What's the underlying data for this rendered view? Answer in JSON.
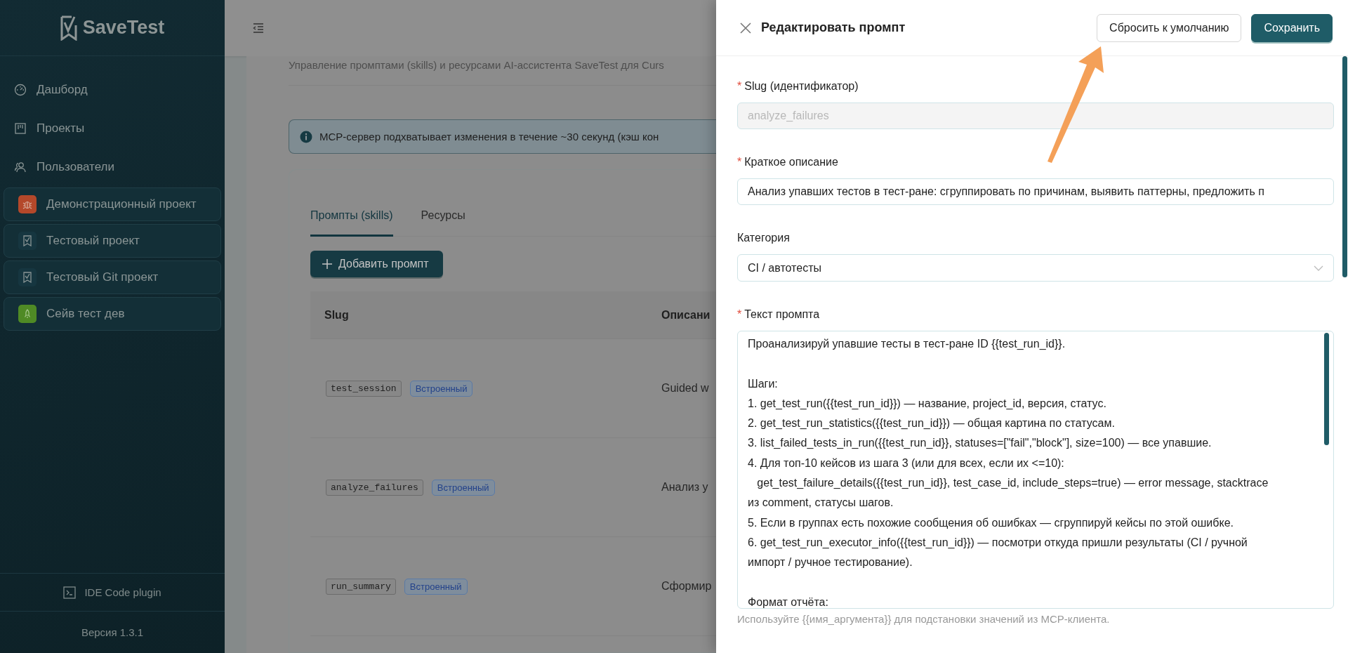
{
  "sidebar": {
    "logo": "SaveTest",
    "nav": [
      {
        "label": "Дашборд"
      },
      {
        "label": "Проекты"
      },
      {
        "label": "Пользователи"
      }
    ],
    "projects": [
      {
        "name": "Демонстрационный проект",
        "color": "#b4482a"
      },
      {
        "name": "Тестовый проект",
        "color": "#163640"
      },
      {
        "name": "Тестовый Git проект",
        "color": "#163640"
      },
      {
        "name": "Сейв тест дев",
        "color": "#4f8a25"
      }
    ],
    "plugin": "IDE Code plugin",
    "version": "Версия 1.3.1"
  },
  "main": {
    "subtitle": "Управление промптами (skills) и ресурсами AI-ассистента SaveTest для Curs",
    "alert": "MCP-сервер подхватывает изменения в течение ~30 секунд (кэш кон",
    "tabs": [
      {
        "label": "Промпты (skills)",
        "selected": true
      },
      {
        "label": "Ресурсы",
        "selected": false
      }
    ],
    "add_button": "Добавить промпт",
    "table": {
      "columns": [
        "Slug",
        "Описани"
      ],
      "rows": [
        {
          "slug": "test_session",
          "badge": "Встроенный",
          "description": "Guided w"
        },
        {
          "slug": "analyze_failures",
          "badge": "Встроенный",
          "description": "Анализ у"
        },
        {
          "slug": "run_summary",
          "badge": "Встроенный",
          "description": "Сформир"
        }
      ]
    }
  },
  "drawer": {
    "title": "Редактировать промпт",
    "reset_button": "Сбросить к умолчанию",
    "save_button": "Сохранить",
    "fields": [
      {
        "kind": "input",
        "label": "Slug (идентификатор)",
        "mark": "*",
        "disabled": true,
        "value": "analyze_failures"
      },
      {
        "kind": "input",
        "label": "Краткое описание",
        "mark": "*",
        "disabled": false,
        "value": "Анализ упавших тестов в тест-ране: сгруппировать по причинам, выявить паттерны, предложить п"
      },
      {
        "kind": "select",
        "label": "Категория",
        "value": "CI / автотесты"
      },
      {
        "kind": "textarea",
        "label": "Текст промпта",
        "mark": "*",
        "value": "Проанализируй упавшие тесты в тест-ране ID {{test_run_id}}.\n\nШаги:\n1. get_test_run({{test_run_id}}) — название, project_id, версия, статус.\n2. get_test_run_statistics({{test_run_id}}) — общая картина по статусам.\n3. list_failed_tests_in_run({{test_run_id}}, statuses=[\"fail\",\"block\"], size=100) — все упавшие.\n4. Для топ-10 кейсов из шага 3 (или для всех, если их <=10):\n   get_test_failure_details({{test_run_id}}, test_case_id, include_steps=true) — error message, stacktrace\nиз comment, статусы шагов.\n5. Если в группах есть похожие сообщения об ошибках — сгруппируй кейсы по этой ошибке.\n6. get_test_run_executor_info({{test_run_id}}) — посмотри откуда пришли результаты (CI / ручной\nимпорт / ручное тестирование).\n\nФормат отчёта:"
      }
    ],
    "hint": "Используйте {{имя_аргумента}} для подстановки значений из MCP-клиента."
  }
}
